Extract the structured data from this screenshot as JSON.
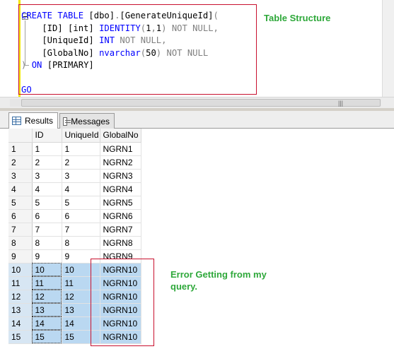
{
  "editor": {
    "code_lines": [
      [
        {
          "t": "CREATE TABLE ",
          "c": "kw"
        },
        {
          "t": "[dbo]",
          "c": "bk"
        },
        {
          "t": ".",
          "c": "gr"
        },
        {
          "t": "[GenerateUniqueId]",
          "c": "bk"
        },
        {
          "t": "(",
          "c": "gr"
        }
      ],
      [
        {
          "t": "    [ID] [int] ",
          "c": "bk"
        },
        {
          "t": "IDENTITY",
          "c": "kw"
        },
        {
          "t": "(",
          "c": "gr"
        },
        {
          "t": "1",
          "c": "bk"
        },
        {
          "t": ",",
          "c": "gr"
        },
        {
          "t": "1",
          "c": "bk"
        },
        {
          "t": ") ",
          "c": "gr"
        },
        {
          "t": "NOT NULL",
          "c": "gr"
        },
        {
          "t": ",",
          "c": "gr"
        }
      ],
      [
        {
          "t": "    [UniqueId] ",
          "c": "bk"
        },
        {
          "t": "INT ",
          "c": "kw"
        },
        {
          "t": "NOT NULL",
          "c": "gr"
        },
        {
          "t": ",",
          "c": "gr"
        }
      ],
      [
        {
          "t": "    [GlobalNo] ",
          "c": "bk"
        },
        {
          "t": "nvarchar",
          "c": "kw"
        },
        {
          "t": "(",
          "c": "gr"
        },
        {
          "t": "50",
          "c": "bk"
        },
        {
          "t": ") ",
          "c": "gr"
        },
        {
          "t": "NOT NULL",
          "c": "gr"
        }
      ],
      [
        {
          "t": ") ",
          "c": "gr"
        },
        {
          "t": "ON ",
          "c": "kw"
        },
        {
          "t": "[PRIMARY]",
          "c": "bk"
        }
      ],
      [
        {
          "t": "",
          "c": "bk"
        }
      ],
      [
        {
          "t": "GO",
          "c": "kw"
        }
      ]
    ],
    "annotation_structure": "Table Structure"
  },
  "tabs": [
    {
      "label": "Results",
      "icon": "grid-icon",
      "active": true
    },
    {
      "label": "Messages",
      "icon": "messages-icon",
      "active": false
    }
  ],
  "grid": {
    "columns": [
      "ID",
      "UniqueId",
      "GlobalNo"
    ],
    "rows": [
      {
        "n": "1",
        "id": "1",
        "uq": "1",
        "gn": "NGRN1"
      },
      {
        "n": "2",
        "id": "2",
        "uq": "2",
        "gn": "NGRN2"
      },
      {
        "n": "3",
        "id": "3",
        "uq": "3",
        "gn": "NGRN3"
      },
      {
        "n": "4",
        "id": "4",
        "uq": "4",
        "gn": "NGRN4"
      },
      {
        "n": "5",
        "id": "5",
        "uq": "5",
        "gn": "NGRN5"
      },
      {
        "n": "6",
        "id": "6",
        "uq": "6",
        "gn": "NGRN6"
      },
      {
        "n": "7",
        "id": "7",
        "uq": "7",
        "gn": "NGRN7"
      },
      {
        "n": "8",
        "id": "8",
        "uq": "8",
        "gn": "NGRN8"
      },
      {
        "n": "9",
        "id": "9",
        "uq": "9",
        "gn": "NGRN9"
      },
      {
        "n": "10",
        "id": "10",
        "uq": "10",
        "gn": "NGRN10"
      },
      {
        "n": "11",
        "id": "11",
        "uq": "11",
        "gn": "NGRN10"
      },
      {
        "n": "12",
        "id": "12",
        "uq": "12",
        "gn": "NGRN10"
      },
      {
        "n": "13",
        "id": "13",
        "uq": "13",
        "gn": "NGRN10"
      },
      {
        "n": "14",
        "id": "14",
        "uq": "14",
        "gn": "NGRN10"
      },
      {
        "n": "15",
        "id": "15",
        "uq": "15",
        "gn": "NGRN10"
      }
    ],
    "selected_rows": [
      "10",
      "11",
      "12",
      "13",
      "14",
      "15"
    ],
    "annotation_error": "Error Getting from my query."
  },
  "colors": {
    "annotation_box": "#c8102e",
    "annotation_text": "#2ea83a",
    "selection": "#bad8f1",
    "keyword": "#0000ff"
  }
}
